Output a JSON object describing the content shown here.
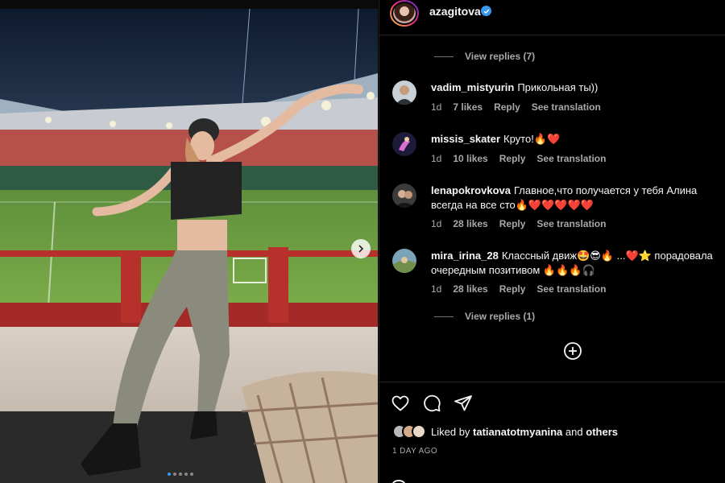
{
  "post": {
    "author": "azagitova",
    "time_ago": "1 DAY AGO"
  },
  "carousel": {
    "slide_count": 5,
    "active_index": 0
  },
  "thread": {
    "view_replies_top": "View replies (7)",
    "view_replies_bottom": "View replies (1)"
  },
  "comments": [
    {
      "user": "vadim_mistyurin",
      "text": "Прикольная ты))",
      "time": "1d",
      "likes": "7 likes",
      "reply": "Reply",
      "translate": "See translation"
    },
    {
      "user": "missis_skater",
      "text": "Круто!🔥❤️",
      "time": "1d",
      "likes": "10 likes",
      "reply": "Reply",
      "translate": "See translation"
    },
    {
      "user": "lenapokrovkova",
      "text": "Главное,что получается у тебя Алина всегда на все сто🔥❤️❤️❤️❤️❤️",
      "time": "1d",
      "likes": "28 likes",
      "reply": "Reply",
      "translate": "See translation"
    },
    {
      "user": "mira_irina_28",
      "text": "Классный движ🤩😎🔥 ...❤️⭐ порадовала очередным позитивом 🔥🔥🔥🎧",
      "time": "1d",
      "likes": "28 likes",
      "reply": "Reply",
      "translate": "See translation"
    }
  ],
  "likes": {
    "prefix": "Liked by",
    "first_user": "tatianatotmyanina",
    "joiner": "and",
    "others": "others"
  },
  "colors": {
    "background": "#000000",
    "text_primary": "#f5f5f5",
    "text_secondary": "#a8a8a8",
    "divider": "#262626",
    "verified_blue": "#3897f0"
  },
  "icons": [
    "verified-badge-icon",
    "add-circle-icon",
    "heart-icon",
    "comment-icon",
    "share-icon",
    "next-slide-icon"
  ]
}
